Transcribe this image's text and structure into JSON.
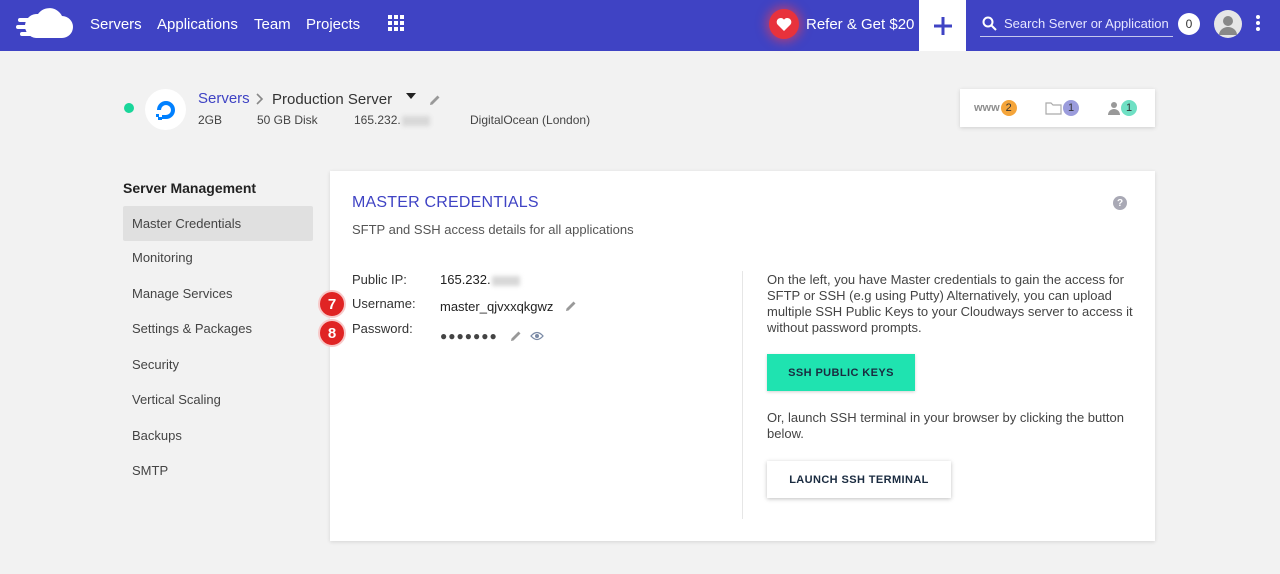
{
  "nav": {
    "links": [
      "Servers",
      "Applications",
      "Team",
      "Projects"
    ],
    "refer_label": "Refer & Get $20",
    "search_placeholder": "Search Server or Application",
    "notification_count": "0"
  },
  "server": {
    "breadcrumb_parent": "Servers",
    "name": "Production Server",
    "ram": "2GB",
    "disk": "50 GB Disk",
    "ip_prefix": "165.232.",
    "location": "DigitalOcean (London)",
    "status_color": "#19d69a"
  },
  "quick": {
    "www_label": "www",
    "www_count": "2",
    "folder_count": "1",
    "users_count": "1",
    "colors": {
      "www": "#f5a53a",
      "folder": "#9b9cdc",
      "users": "#6fe0c4"
    }
  },
  "sidebar": {
    "title": "Server Management",
    "items": [
      {
        "label": "Master Credentials",
        "active": true
      },
      {
        "label": "Monitoring"
      },
      {
        "label": "Manage Services"
      },
      {
        "label": "Settings & Packages"
      },
      {
        "label": "Security"
      },
      {
        "label": "Vertical Scaling"
      },
      {
        "label": "Backups"
      },
      {
        "label": "SMTP"
      }
    ]
  },
  "credentials": {
    "title": "MASTER CREDENTIALS",
    "subtitle": "SFTP and SSH access details for all applications",
    "help": "?",
    "public_ip_label": "Public IP:",
    "public_ip_prefix": "165.232.",
    "username_label": "Username:",
    "username_value": "master_qjvxxqkgwz",
    "password_label": "Password:",
    "password_masked": "●●●●●●●",
    "step_username": "7",
    "step_password": "8",
    "info_text": "On the left, you have Master credentials to gain the access for SFTP or SSH (e.g using Putty) Alternatively, you can upload multiple SSH Public Keys to your Cloudways server to access it without password prompts.",
    "ssh_keys_button": "SSH PUBLIC KEYS",
    "terminal_info": "Or, launch SSH terminal in your browser by clicking the button below.",
    "terminal_button": "LAUNCH SSH TERMINAL"
  },
  "colors": {
    "brand": "#3f43c4",
    "accent": "#1fe3b0",
    "badge": "#e02424"
  }
}
